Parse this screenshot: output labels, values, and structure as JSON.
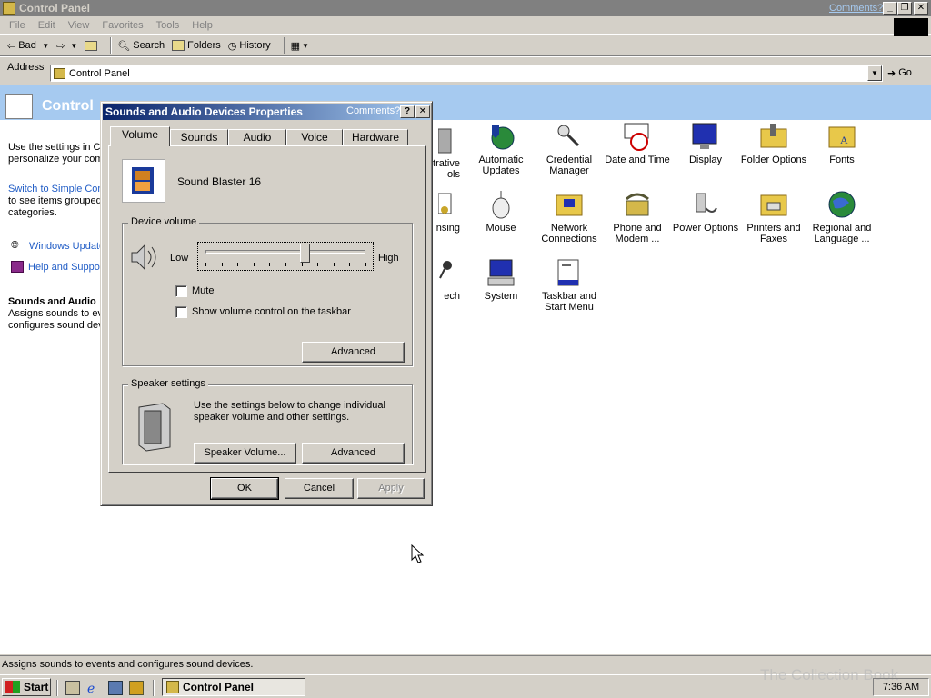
{
  "window": {
    "title": "Control Panel",
    "comments_link": "Comments?"
  },
  "menu": [
    "File",
    "Edit",
    "View",
    "Favorites",
    "Tools",
    "Help"
  ],
  "toolbar": {
    "back": "Back",
    "search": "Search",
    "folders": "Folders",
    "history": "History"
  },
  "address": {
    "label": "Address",
    "value": "Control Panel",
    "go": "Go"
  },
  "control_panel": {
    "banner_title": "Control",
    "left_text_1": "Use the settings in Co",
    "left_text_2": "personalize your com",
    "switch_link_1": "Switch to Simple Cont",
    "switch_text_1": "to see items grouped",
    "switch_text_2": "categories.",
    "windows_update": "Windows Update",
    "help_support": "Help and Suppor",
    "selected_title": "Sounds and Audio",
    "selected_desc_1": "Assigns sounds to ev",
    "selected_desc_2": "configures sound dev",
    "icons_row1": [
      {
        "label1": "strative",
        "label2": "ols",
        "icon": "admin-tools-icon"
      },
      {
        "label1": "Automatic",
        "label2": "Updates",
        "icon": "globe-shield-icon"
      },
      {
        "label1": "Credential",
        "label2": "Manager",
        "icon": "key-icon"
      },
      {
        "label1": "Date and Time",
        "label2": "",
        "icon": "clock-calendar-icon"
      },
      {
        "label1": "Display",
        "label2": "",
        "icon": "monitor-icon"
      },
      {
        "label1": "Folder Options",
        "label2": "",
        "icon": "folder-options-icon"
      },
      {
        "label1": "Fonts",
        "label2": "",
        "icon": "fonts-folder-icon"
      }
    ],
    "icons_row2": [
      {
        "label1": "nsing",
        "label2": "",
        "icon": "licensing-icon"
      },
      {
        "label1": "Mouse",
        "label2": "",
        "icon": "mouse-icon"
      },
      {
        "label1": "Network",
        "label2": "Connections",
        "icon": "network-folder-icon"
      },
      {
        "label1": "Phone and",
        "label2": "Modem ...",
        "icon": "phone-icon"
      },
      {
        "label1": "Power Options",
        "label2": "",
        "icon": "power-icon"
      },
      {
        "label1": "Printers and",
        "label2": "Faxes",
        "icon": "printer-folder-icon"
      },
      {
        "label1": "Regional and",
        "label2": "Language ...",
        "icon": "globe-icon"
      }
    ],
    "icons_row3": [
      {
        "label1": "ech",
        "label2": "",
        "icon": "speech-icon"
      },
      {
        "label1": "System",
        "label2": "",
        "icon": "computer-icon"
      },
      {
        "label1": "Taskbar and",
        "label2": "Start Menu",
        "icon": "taskbar-icon"
      }
    ]
  },
  "status_bar": "Assigns sounds to events and configures sound devices.",
  "taskbar": {
    "start": "Start",
    "task": "Control Panel",
    "clock": "7:36 AM",
    "watermark": "The Collection Book"
  },
  "dialog": {
    "title": "Sounds and Audio Devices Properties",
    "comments": "Comments?",
    "help": "?",
    "close": "✕",
    "tabs": [
      "Volume",
      "Sounds",
      "Audio",
      "Voice",
      "Hardware"
    ],
    "device_name": "Sound Blaster 16",
    "device_volume": "Device volume",
    "low": "Low",
    "high": "High",
    "volume_level": 0.62,
    "mute": "Mute",
    "show_volume": "Show volume control on the taskbar",
    "advanced": "Advanced",
    "speaker_settings": "Speaker settings",
    "speaker_text_1": "Use the settings below to change individual",
    "speaker_text_2": "speaker volume and other settings.",
    "speaker_volume": "Speaker Volume...",
    "advanced2": "Advanced",
    "ok": "OK",
    "cancel": "Cancel",
    "apply": "Apply"
  }
}
